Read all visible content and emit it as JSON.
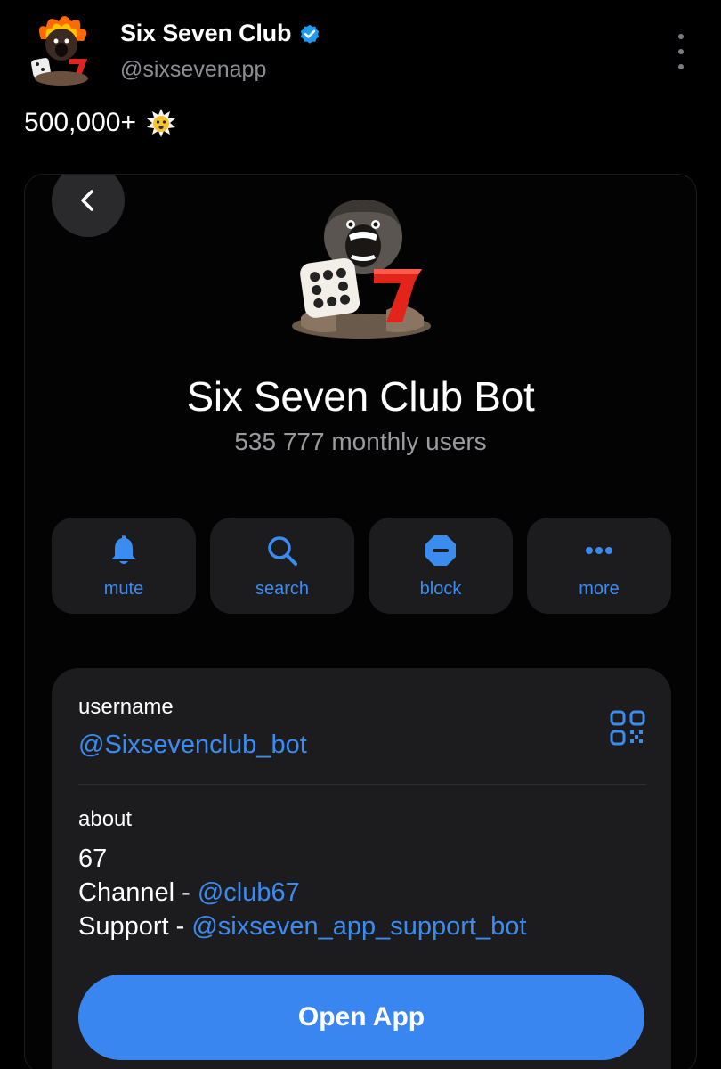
{
  "tweet": {
    "author_name": "Six Seven Club",
    "author_handle": "@sixsevenapp",
    "text": "500,000+",
    "text_emoji": "star-struck-emoji",
    "verified": true
  },
  "embedded": {
    "bot_name": "Six Seven Club Bot",
    "subtitle": "535 777 monthly users",
    "actions": [
      {
        "label": "mute",
        "icon": "bell-icon"
      },
      {
        "label": "search",
        "icon": "search-icon"
      },
      {
        "label": "block",
        "icon": "block-icon"
      },
      {
        "label": "more",
        "icon": "more-dots-icon"
      }
    ],
    "info": {
      "username_label": "username",
      "username_value": "@Sixsevenclub_bot",
      "about_label": "about",
      "about_line1": "67",
      "channel_prefix": "Channel - ",
      "channel_link": "@club67",
      "support_prefix": "Support - ",
      "support_link": "@sixseven_app_support_bot"
    },
    "open_button": "Open App"
  },
  "colors": {
    "accent": "#3b8cf0",
    "button": "#3a86f0",
    "panel": "#1c1c1e",
    "background": "#000000",
    "verified": "#1d9bf0"
  }
}
